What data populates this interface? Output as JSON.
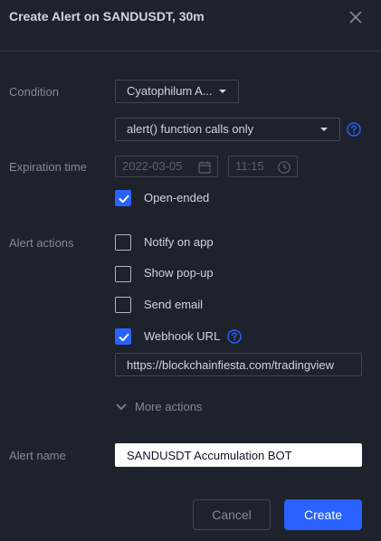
{
  "dialog": {
    "title": "Create Alert on SANDUSDT, 30m",
    "close_icon": "close-icon"
  },
  "condition": {
    "label": "Condition",
    "indicator": "Cyatophilum A...",
    "trigger": "alert() function calls only",
    "help_icon": "question-circle-icon"
  },
  "expiration": {
    "label": "Expiration time",
    "date": "2022-03-05",
    "time": "11:15",
    "date_icon": "calendar-icon",
    "time_icon": "clock-icon",
    "open_ended_label": "Open-ended",
    "open_ended_checked": true
  },
  "actions": {
    "label": "Alert actions",
    "items": [
      {
        "label": "Notify on app",
        "checked": false
      },
      {
        "label": "Show pop-up",
        "checked": false
      },
      {
        "label": "Send email",
        "checked": false
      },
      {
        "label": "Webhook URL",
        "checked": true
      }
    ],
    "webhook_url": "https://blockchainfiesta.com/tradingview",
    "more_actions": "More actions"
  },
  "alert_name": {
    "label": "Alert name",
    "value": "SANDUSDT Accumulation BOT"
  },
  "buttons": {
    "cancel": "Cancel",
    "create": "Create"
  },
  "colors": {
    "background": "#1e222d",
    "accent": "#2962ff",
    "text": "#d1d4dc",
    "muted": "#868993"
  }
}
